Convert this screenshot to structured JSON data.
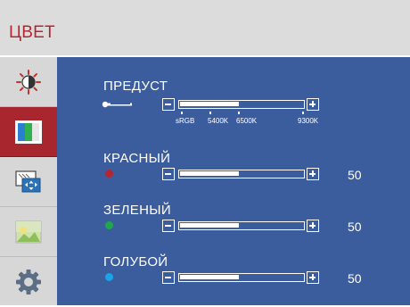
{
  "window": {
    "title": "ЦВЕТ"
  },
  "sidebar": {
    "items": [
      {
        "id": "brightness",
        "icon": "brightness-contrast-icon",
        "active": false
      },
      {
        "id": "color",
        "icon": "color-bars-icon",
        "active": true
      },
      {
        "id": "image",
        "icon": "picture-size-icon",
        "active": false
      },
      {
        "id": "photo",
        "icon": "photo-icon",
        "active": false
      },
      {
        "id": "settings",
        "icon": "gear-icon",
        "active": false
      }
    ]
  },
  "colors": {
    "accent": "#a8262d",
    "panel": "#3c5d9d",
    "red_dot": "#b3262f",
    "green_dot": "#1fa84a",
    "blue_dot": "#1aa3e6"
  },
  "preset": {
    "label": "ПРЕДУСТ",
    "icon": "key-icon",
    "level": 0.48,
    "options": [
      "sRGB",
      "5400K",
      "6500K",
      "9300K"
    ]
  },
  "channels": [
    {
      "label": "КРАСНЫЙ",
      "value": "50",
      "level": 0.48
    },
    {
      "label": "ЗЕЛЕНЫЙ",
      "value": "50",
      "level": 0.48
    },
    {
      "label": "ГОЛУБОЙ",
      "value": "50",
      "level": 0.48
    }
  ]
}
